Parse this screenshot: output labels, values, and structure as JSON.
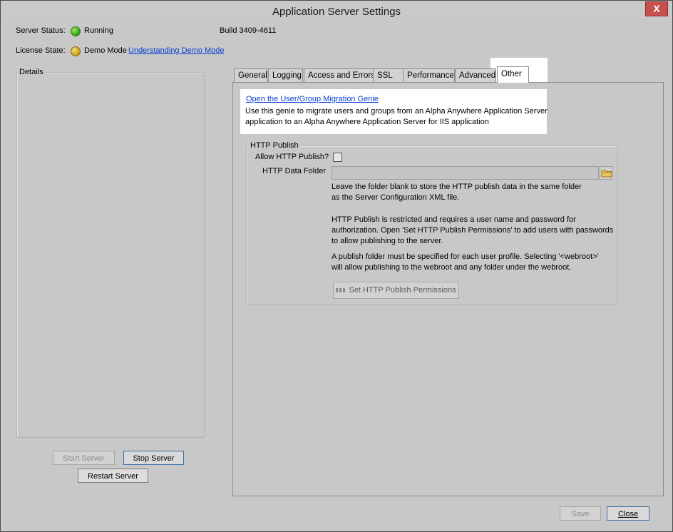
{
  "window": {
    "title": "Application Server Settings",
    "close_glyph": "X"
  },
  "status": {
    "server_label": "Server Status:",
    "server_value": "Running",
    "build": "Build 3409-4611",
    "license_label": "License State:",
    "license_value": "Demo Mode",
    "license_link": "Understanding Demo Mode"
  },
  "details": {
    "label": "Details"
  },
  "buttons": {
    "start": "Start Server",
    "stop": "Stop Server",
    "restart": "Restart Server",
    "save": "Save",
    "close": "Close"
  },
  "tabs": [
    {
      "label": "General"
    },
    {
      "label": "Logging"
    },
    {
      "label": "Access and Errors"
    },
    {
      "label": "SSL"
    },
    {
      "label": "Performance"
    },
    {
      "label": "Advanced"
    },
    {
      "label": "Other",
      "selected": true
    }
  ],
  "other": {
    "genie_link": "Open the User/Group Migration Genie",
    "genie_desc_line1": "Use this genie to migrate users and groups from an Alpha Anywhere Application Server",
    "genie_desc_line2": "application to an Alpha Anywhere Application Server for IIS application",
    "http_publish": {
      "group_label": "HTTP Publish",
      "allow_label": "Allow HTTP Publish?",
      "allow_checked": false,
      "folder_label": "HTTP Data Folder",
      "folder_value": "",
      "note1_line1": "Leave the folder blank to store the HTTP publish data in the same folder",
      "note1_line2": "as the Server Configuration XML file.",
      "note2_line1": "HTTP Publish is restricted and requires a user name and password for",
      "note2_line2": "authorization. Open 'Set HTTP Publish Permissions' to add users with passwords",
      "note2_line3": "to allow publishing to the server.",
      "note3_line1": "A publish folder must be specified for each user profile.  Selecting '<webroot>'",
      "note3_line2": "will allow publishing to the webroot and any folder under the webroot.",
      "permissions_button": "Set HTTP Publish Permissions"
    }
  },
  "colors": {
    "link": "#0a3fd0",
    "running": "#2b9c10",
    "demo": "#c79a10",
    "close_button": "#c7504f"
  }
}
